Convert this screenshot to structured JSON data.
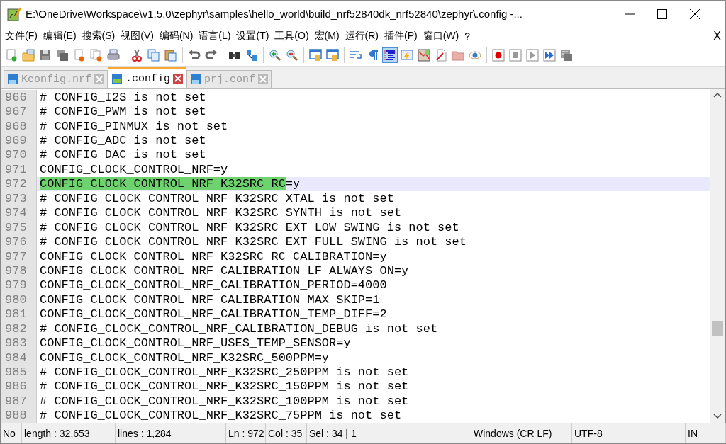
{
  "window": {
    "title": "E:\\OneDrive\\Workspace\\v1.5.0\\zephyr\\samples\\hello_world\\build_nrf52840dk_nrf52840\\zephyr\\.config -..."
  },
  "menu": {
    "items": [
      "文件(F)",
      "编辑(E)",
      "搜索(S)",
      "视图(V)",
      "编码(N)",
      "语言(L)",
      "设置(T)",
      "工具(O)",
      "宏(M)",
      "运行(R)",
      "插件(P)",
      "窗口(W)",
      "?"
    ],
    "close": "X"
  },
  "toolbar": [
    {
      "kind": "new",
      "pressed": false
    },
    {
      "kind": "open",
      "pressed": false
    },
    {
      "kind": "save",
      "pressed": false
    },
    {
      "kind": "save-all",
      "pressed": false
    },
    {
      "kind": "close",
      "pressed": false
    },
    {
      "kind": "close-all",
      "pressed": false
    },
    {
      "kind": "print",
      "pressed": false
    },
    {
      "kind": "separator"
    },
    {
      "kind": "cut",
      "pressed": false
    },
    {
      "kind": "copy",
      "pressed": false
    },
    {
      "kind": "paste",
      "pressed": false
    },
    {
      "kind": "separator"
    },
    {
      "kind": "undo",
      "pressed": false
    },
    {
      "kind": "redo",
      "pressed": false
    },
    {
      "kind": "separator"
    },
    {
      "kind": "find",
      "pressed": false
    },
    {
      "kind": "replace",
      "pressed": false
    },
    {
      "kind": "separator"
    },
    {
      "kind": "zoom-in",
      "pressed": false
    },
    {
      "kind": "zoom-out",
      "pressed": false
    },
    {
      "kind": "separator"
    },
    {
      "kind": "window-lock",
      "pressed": false
    },
    {
      "kind": "window-lock",
      "pressed": false
    },
    {
      "kind": "separator"
    },
    {
      "kind": "wrap",
      "pressed": false
    },
    {
      "kind": "pilcrow",
      "pressed": false
    },
    {
      "kind": "indent-guide",
      "pressed": true
    },
    {
      "kind": "lightning",
      "pressed": false
    },
    {
      "kind": "map",
      "pressed": false
    },
    {
      "kind": "document",
      "pressed": false
    },
    {
      "kind": "folder",
      "pressed": false
    },
    {
      "kind": "eye",
      "pressed": false
    },
    {
      "kind": "separator"
    },
    {
      "kind": "record",
      "pressed": false
    },
    {
      "kind": "stop",
      "pressed": false
    },
    {
      "kind": "play",
      "pressed": false
    },
    {
      "kind": "fast-forward",
      "pressed": false
    },
    {
      "kind": "macro-save",
      "pressed": false
    }
  ],
  "tabs": [
    {
      "label": "Kconfig.nrf",
      "selected": false
    },
    {
      "label": ".config",
      "selected": true
    },
    {
      "label": "prj.conf",
      "selected": false
    }
  ],
  "editor": {
    "lines": [
      {
        "number": "966",
        "text": "# CONFIG_I2S is not set",
        "current": false
      },
      {
        "number": "967",
        "text": "# CONFIG_PWM is not set",
        "current": false
      },
      {
        "number": "968",
        "text": "# CONFIG_PINMUX is not set",
        "current": false
      },
      {
        "number": "969",
        "text": "# CONFIG_ADC is not set",
        "current": false
      },
      {
        "number": "970",
        "text": "# CONFIG_DAC is not set",
        "current": false
      },
      {
        "number": "971",
        "text": "CONFIG_CLOCK_CONTROL_NRF=y",
        "current": false
      },
      {
        "number": "972",
        "selected_text": "CONFIG_CLOCK_CONTROL_NRF_K32SRC_RC",
        "text": "=y",
        "current": true
      },
      {
        "number": "973",
        "text": "# CONFIG_CLOCK_CONTROL_NRF_K32SRC_XTAL is not set",
        "current": false
      },
      {
        "number": "974",
        "text": "# CONFIG_CLOCK_CONTROL_NRF_K32SRC_SYNTH is not set",
        "current": false
      },
      {
        "number": "975",
        "text": "# CONFIG_CLOCK_CONTROL_NRF_K32SRC_EXT_LOW_SWING is not set",
        "current": false
      },
      {
        "number": "976",
        "text": "# CONFIG_CLOCK_CONTROL_NRF_K32SRC_EXT_FULL_SWING is not set",
        "current": false
      },
      {
        "number": "977",
        "text": "CONFIG_CLOCK_CONTROL_NRF_K32SRC_RC_CALIBRATION=y",
        "current": false
      },
      {
        "number": "978",
        "text": "CONFIG_CLOCK_CONTROL_NRF_CALIBRATION_LF_ALWAYS_ON=y",
        "current": false
      },
      {
        "number": "979",
        "text": "CONFIG_CLOCK_CONTROL_NRF_CALIBRATION_PERIOD=4000",
        "current": false
      },
      {
        "number": "980",
        "text": "CONFIG_CLOCK_CONTROL_NRF_CALIBRATION_MAX_SKIP=1",
        "current": false
      },
      {
        "number": "981",
        "text": "CONFIG_CLOCK_CONTROL_NRF_CALIBRATION_TEMP_DIFF=2",
        "current": false
      },
      {
        "number": "982",
        "text": "# CONFIG_CLOCK_CONTROL_NRF_CALIBRATION_DEBUG is not set",
        "current": false
      },
      {
        "number": "983",
        "text": "CONFIG_CLOCK_CONTROL_NRF_USES_TEMP_SENSOR=y",
        "current": false
      },
      {
        "number": "984",
        "text": "CONFIG_CLOCK_CONTROL_NRF_K32SRC_500PPM=y",
        "current": false
      },
      {
        "number": "985",
        "text": "# CONFIG_CLOCK_CONTROL_NRF_K32SRC_250PPM is not set",
        "current": false
      },
      {
        "number": "986",
        "text": "# CONFIG_CLOCK_CONTROL_NRF_K32SRC_150PPM is not set",
        "current": false
      },
      {
        "number": "987",
        "text": "# CONFIG_CLOCK_CONTROL_NRF_K32SRC_100PPM is not set",
        "current": false
      },
      {
        "number": "988",
        "text": "# CONFIG_CLOCK_CONTROL_NRF_K32SRC_75PPM is not set",
        "current": false
      }
    ]
  },
  "status_bar": [
    "No",
    "length : 32,653",
    "lines : 1,284",
    "Ln : 972",
    "Col : 35",
    "Sel : 34 | 1",
    "Windows (CR LF)",
    "UTF-8",
    "IN"
  ]
}
